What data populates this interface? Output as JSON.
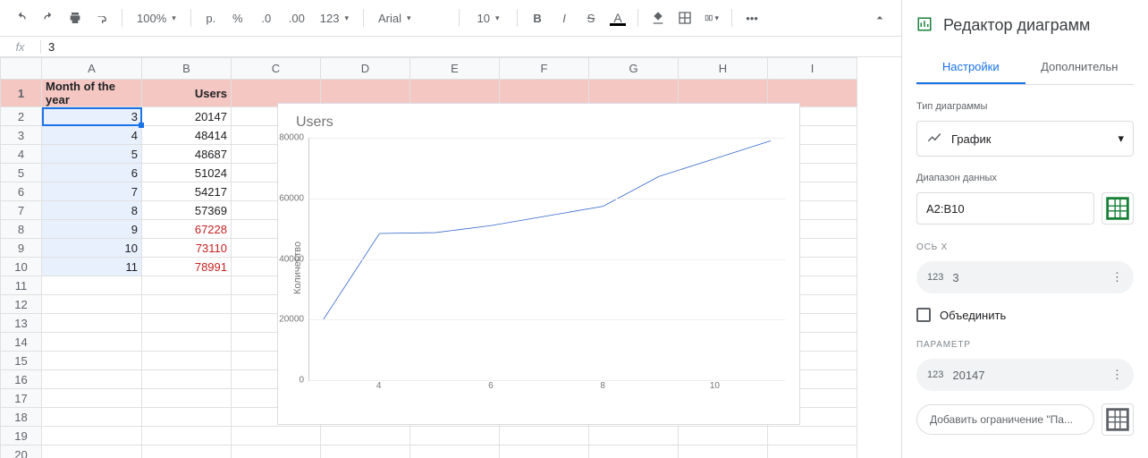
{
  "toolbar": {
    "zoom": "100%",
    "currency_short": "р.",
    "percent": "%",
    "dec_dec": ".0",
    "dec_inc": ".00",
    "numfmt": "123",
    "font": "Arial",
    "font_size": "10"
  },
  "formula_bar": {
    "label": "fx",
    "value": "3"
  },
  "columns": [
    "A",
    "B",
    "C",
    "D",
    "E",
    "F",
    "G",
    "H",
    "I"
  ],
  "header_row": {
    "a": "Month of the year",
    "b": "Users"
  },
  "rows": [
    {
      "n": "1"
    },
    {
      "n": "2",
      "a": "3",
      "b": "20147",
      "neg": false
    },
    {
      "n": "3",
      "a": "4",
      "b": "48414",
      "neg": false
    },
    {
      "n": "4",
      "a": "5",
      "b": "48687",
      "neg": false
    },
    {
      "n": "5",
      "a": "6",
      "b": "51024",
      "neg": false
    },
    {
      "n": "6",
      "a": "7",
      "b": "54217",
      "neg": false
    },
    {
      "n": "7",
      "a": "8",
      "b": "57369",
      "neg": false
    },
    {
      "n": "8",
      "a": "9",
      "b": "67228",
      "neg": true
    },
    {
      "n": "9",
      "a": "10",
      "b": "73110",
      "neg": true
    },
    {
      "n": "10",
      "a": "11",
      "b": "78991",
      "neg": true
    },
    {
      "n": "11"
    },
    {
      "n": "12"
    },
    {
      "n": "13"
    },
    {
      "n": "14"
    },
    {
      "n": "15"
    },
    {
      "n": "16"
    },
    {
      "n": "17"
    },
    {
      "n": "18"
    },
    {
      "n": "19"
    },
    {
      "n": "20"
    }
  ],
  "chart_data": {
    "type": "line",
    "title": "Users",
    "ylabel": "Количество",
    "x": [
      3,
      4,
      5,
      6,
      7,
      8,
      9,
      10,
      11
    ],
    "values": [
      20147,
      48414,
      48687,
      51024,
      54217,
      57369,
      67228,
      73110,
      78991
    ],
    "ylim": [
      0,
      80000
    ],
    "yticks": [
      0,
      20000,
      40000,
      60000,
      80000
    ],
    "xtick_labels": [
      "4",
      "6",
      "8",
      "10"
    ],
    "xtick_positions": [
      4,
      6,
      8,
      10
    ]
  },
  "sidebar": {
    "title": "Редактор диаграмм",
    "tabs": {
      "settings": "Настройки",
      "customize": "Дополнительн"
    },
    "chart_type_label": "Тип диаграммы",
    "chart_type_value": "График",
    "range_label": "Диапазон данных",
    "range_value": "A2:B10",
    "xaxis_caps": "ОСЬ X",
    "xaxis_value": "3",
    "combine_label": "Объединить",
    "param_caps": "ПАРАМЕТР",
    "param_value": "20147",
    "add_label": "Добавить ограничение \"Па..."
  }
}
